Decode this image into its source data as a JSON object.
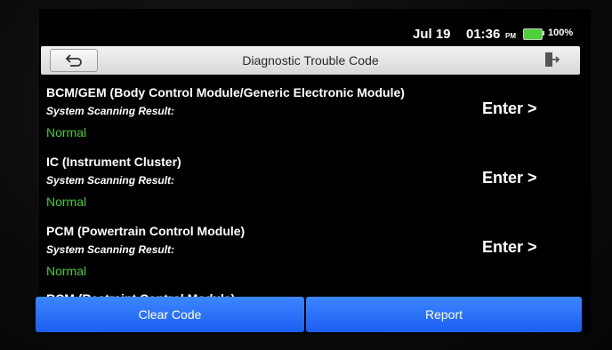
{
  "status_bar": {
    "date": "Jul 19",
    "time": "01:36",
    "ampm": "PM",
    "battery": "100%"
  },
  "header": {
    "title": "Diagnostic Trouble Code",
    "back_icon": "back-arrow-icon",
    "exit_icon": "exit-icon"
  },
  "modules": [
    {
      "name": "BCM/GEM (Body Control Module/Generic Electronic Module)",
      "scan_label": "System Scanning Result:",
      "status": "Normal",
      "enter_label": "Enter >"
    },
    {
      "name": "IC (Instrument Cluster)",
      "scan_label": "System Scanning Result:",
      "status": "Normal",
      "enter_label": "Enter >"
    },
    {
      "name": "PCM (Powertrain Control Module)",
      "scan_label": "System Scanning Result:",
      "status": "Normal",
      "enter_label": "Enter >"
    }
  ],
  "partial_item": "RCM (Restraint Control Module)",
  "footer": {
    "clear_label": "Clear Code",
    "report_label": "Report"
  },
  "colors": {
    "status_normal": "#47c93c",
    "button_blue": "#2a6ff7",
    "battery_green": "#4cd137"
  }
}
